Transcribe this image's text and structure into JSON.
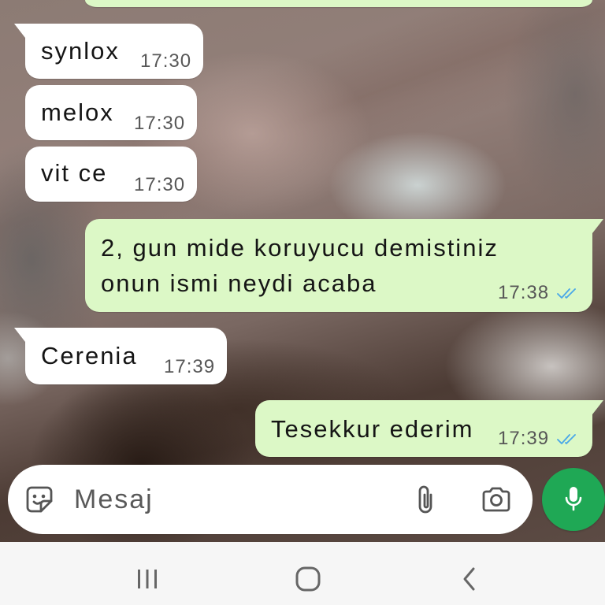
{
  "chat": {
    "messages": [
      {
        "direction": "incoming",
        "text": "synlox",
        "time": "17:30"
      },
      {
        "direction": "incoming",
        "text": "melox",
        "time": "17:30"
      },
      {
        "direction": "incoming",
        "text": "vit ce",
        "time": "17:30"
      },
      {
        "direction": "outgoing",
        "text": "2, gun mide koruyucu demistiniz onun ismi neydi acaba",
        "time": "17:38",
        "status_icon": "double-check-read-icon"
      },
      {
        "direction": "incoming",
        "text": "Cerenia",
        "time": "17:39"
      },
      {
        "direction": "outgoing",
        "text": "Tesekkur ederim",
        "time": "17:39",
        "status_icon": "double-check-read-icon"
      }
    ]
  },
  "composer": {
    "placeholder": "Mesaj",
    "sticker_icon": "sticker-icon",
    "attach_icon": "paperclip-icon",
    "camera_icon": "camera-icon",
    "voice_button_icon": "mic-icon"
  },
  "system_nav": {
    "recent_apps_icon": "recent-apps-icon",
    "home_icon": "home-icon",
    "back_icon": "back-icon"
  },
  "colors": {
    "incoming_bubble": "#ffffff",
    "outgoing_bubble": "#dcf8c6",
    "accent": "#1fa855",
    "read_receipt": "#4aa8e8",
    "nav_bar": "#f6f6f6"
  }
}
